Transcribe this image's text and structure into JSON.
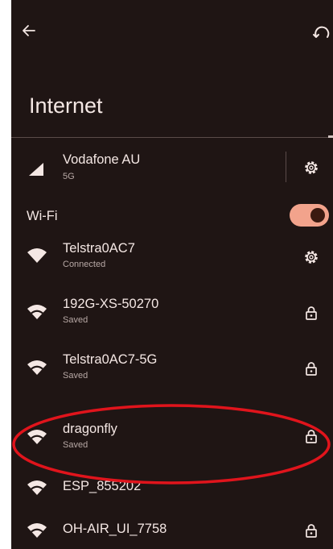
{
  "header": {
    "title": "Internet",
    "back_icon": "arrow-left-icon",
    "sync_icon": "sync-icon"
  },
  "mobile": {
    "name": "Vodafone AU",
    "subtitle": "5G",
    "signal_icon": "cellular-signal-icon",
    "settings_icon": "gear-icon"
  },
  "wifi": {
    "label": "Wi-Fi",
    "enabled": true,
    "toggle_color": "#f2a38c",
    "networks": [
      {
        "name": "Telstra0AC7",
        "status": "Connected",
        "trail_icon": "gear-icon"
      },
      {
        "name": "192G-XS-50270",
        "status": "Saved",
        "trail_icon": "lock-icon"
      },
      {
        "name": "Telstra0AC7-5G",
        "status": "Saved",
        "trail_icon": "lock-icon"
      },
      {
        "name": "dragonfly",
        "status": "Saved",
        "trail_icon": "lock-icon",
        "highlighted": true
      },
      {
        "name": "ESP_855202",
        "status": "",
        "trail_icon": ""
      },
      {
        "name": "OH-AIR_UI_7758",
        "status": "",
        "trail_icon": "lock-icon"
      }
    ]
  },
  "annotation": {
    "ring_color": "#e0141c"
  }
}
